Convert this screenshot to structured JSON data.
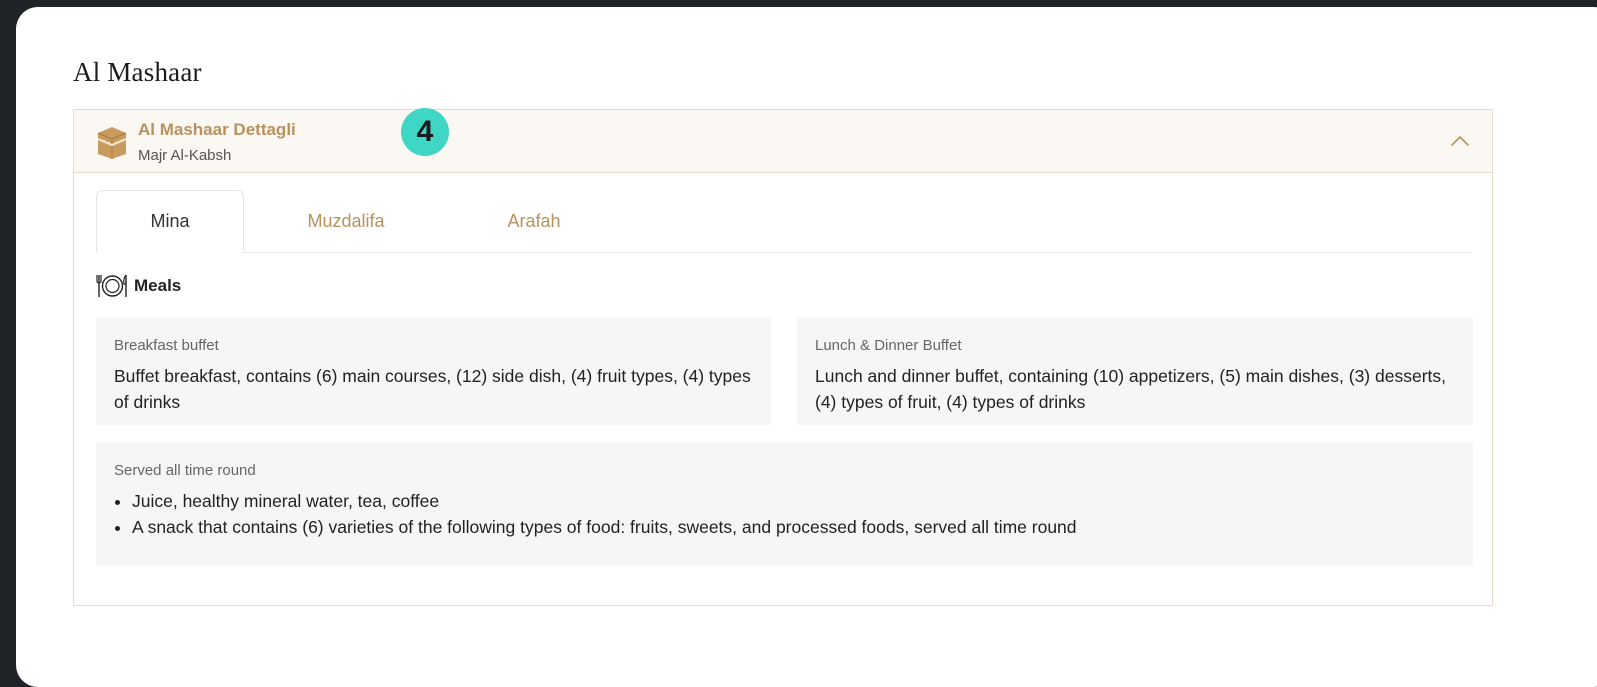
{
  "section": {
    "title": "Al Mashaar"
  },
  "accordion": {
    "title": "Al Mashaar Dettagli",
    "subtitle": "Majr Al-Kabsh",
    "step_badge": "4",
    "toggle_icon": "chevron-up-icon",
    "leading_icon": "kaaba-icon",
    "expanded": true
  },
  "tabs": [
    {
      "label": "Mina",
      "active": true
    },
    {
      "label": "Muzdalifa",
      "active": false
    },
    {
      "label": "Arafah",
      "active": false
    }
  ],
  "meals": {
    "heading": "Meals",
    "icon": "plate-cutlery-icon",
    "cards": [
      {
        "label": "Breakfast buffet",
        "text": "Buffet breakfast, contains (6) main courses, (12) side dish, (4) fruit types, (4) types of drinks"
      },
      {
        "label": "Lunch & Dinner Buffet",
        "text": "Lunch and dinner buffet, containing (10) appetizers, (5) main dishes, (3) desserts, (4) types of fruit, (4) types of drinks"
      }
    ],
    "all_time": {
      "label": "Served all time round",
      "items": [
        "Juice, healthy mineral water, tea, coffee",
        "A snack that contains (6) varieties of the following types of food: fruits, sweets, and processed foods, served all time round"
      ]
    }
  },
  "colors": {
    "accent": "#b8925e",
    "badge": "#3fd6c6",
    "header_bg": "#fbf7f2",
    "card_bg": "#f5f6f8",
    "border": "#e7dcc9"
  }
}
